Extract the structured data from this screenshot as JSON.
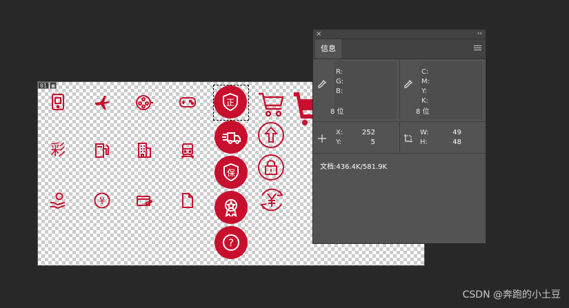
{
  "canvas": {
    "slice_number": "01",
    "slice_badge_icon": "image-icon",
    "icon_color": "#c8102e",
    "glyphs": {
      "cai": "彩",
      "zheng": "正",
      "bao": "保",
      "help": "?",
      "yen": "¥"
    }
  },
  "info_panel": {
    "close_glyph": "×",
    "collapse_glyph": "‹‹",
    "tab_label": "信息",
    "rgb_labels": [
      "R:",
      "G:",
      "B:"
    ],
    "cmyk_labels": [
      "C:",
      "M:",
      "Y:",
      "K:"
    ],
    "bit_depth_left": "8 位",
    "bit_depth_right": "8 位",
    "x_label": "X:",
    "x_value": "252",
    "y_label": "Y:",
    "y_value": "5",
    "w_label": "W:",
    "w_value": "49",
    "h_label": "H:",
    "h_value": "48",
    "doc_size": "文档:436.4K/581.9K"
  },
  "watermark": "CSDN @奔跑的小土豆"
}
